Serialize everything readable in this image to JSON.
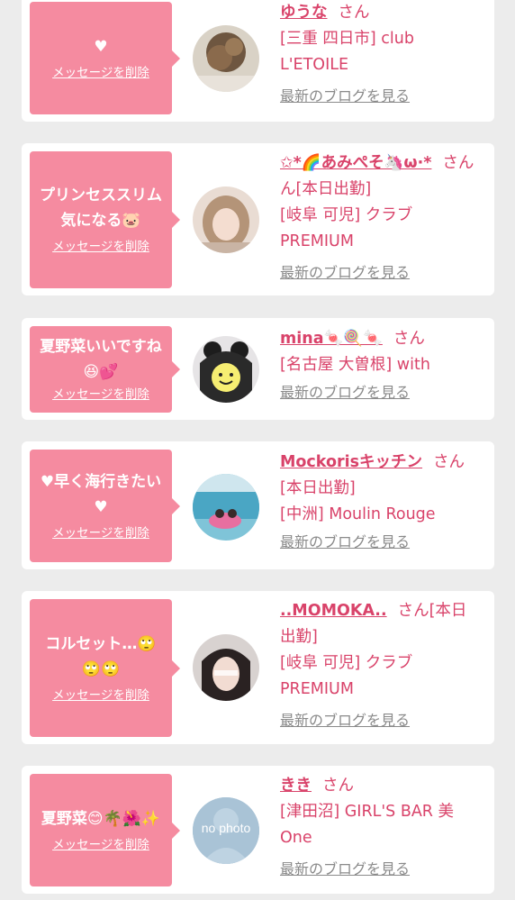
{
  "delete_label": "メッセージを削除",
  "blog_label": "最新のブログを見る",
  "san": "さん",
  "cards": [
    {
      "message": "♥",
      "name": "ゆうな",
      "locations": [
        "[三重 四日市] club",
        "L'ETOILE"
      ]
    },
    {
      "message": "プリンセススリム気になる🐷",
      "name": "✩*🌈あみぺそ🦄ω·*",
      "locations": [
        "ん[本日出勤]",
        "[岐阜 可児] クラブ",
        "PREMIUM"
      ]
    },
    {
      "message": "夏野菜いいですね😆💕",
      "name": "mina🍬🍭🍬",
      "locations": [
        "[名古屋 大曽根] with"
      ]
    },
    {
      "message": "♥早く海行きたい♥",
      "name": "Mockorisキッチン",
      "locations": [
        "[本日出勤]",
        "[中洲] Moulin Rouge"
      ]
    },
    {
      "message": "コルセット…🙄🙄🙄",
      "name": "..MOMOKA..",
      "locations": [
        "出勤]",
        "[岐阜 可児] クラブ",
        "PREMIUM"
      ],
      "san_suffix": "[本日"
    },
    {
      "message": "夏野菜😊🌴🌺✨",
      "name": "きき",
      "locations": [
        "[津田沼] GIRL'S BAR 美",
        "One"
      ],
      "avatar_text": "no photo"
    }
  ],
  "colors": {
    "accent": "#d9436a",
    "bubble": "#f58ba0",
    "background": "#ececec",
    "link_gray": "#8a8a8a"
  }
}
